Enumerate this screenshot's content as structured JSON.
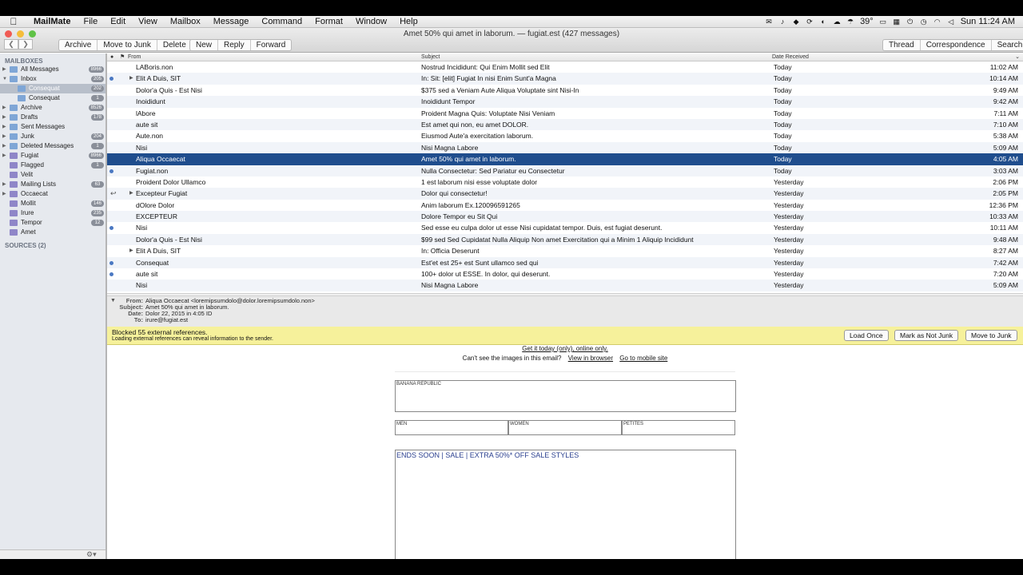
{
  "menubar": {
    "app_name": "MailMate",
    "items": [
      "File",
      "Edit",
      "View",
      "Mailbox",
      "Message",
      "Command",
      "Format",
      "Window",
      "Help"
    ],
    "temperature": "39°",
    "clock": "Sun 11:24 AM"
  },
  "window": {
    "title": "Amet 50% qui amet in laborum. — fugiat.est (427 messages)"
  },
  "toolbar": {
    "group1": [
      "Archive",
      "Move to Junk",
      "Delete"
    ],
    "group2": [
      "New",
      "Reply",
      "Forward"
    ],
    "group3": [
      "Thread",
      "Correspondence",
      "Search"
    ]
  },
  "sidebar": {
    "heading": "MAILBOXES",
    "items": [
      {
        "label": "All Messages",
        "count": "8966",
        "tri": "▶",
        "folder": "b"
      },
      {
        "label": "Inbox",
        "count": "205",
        "tri": "▼",
        "folder": "b"
      },
      {
        "label": "Consequat",
        "count": "202",
        "tri": "",
        "folder": "b",
        "indent": true
      },
      {
        "label": "Consequat",
        "count": "1",
        "tri": "",
        "folder": "b",
        "indent": true
      },
      {
        "label": "Archive",
        "count": "8526",
        "tri": "▶",
        "folder": "b"
      },
      {
        "label": "Drafts",
        "count": "178",
        "tri": "▶",
        "folder": "b"
      },
      {
        "label": "Sent Messages",
        "count": "",
        "tri": "▶",
        "folder": "b"
      },
      {
        "label": "Junk",
        "count": "204",
        "tri": "▶",
        "folder": "b"
      },
      {
        "label": "Deleted Messages",
        "count": "1",
        "tri": "▶",
        "folder": "b"
      },
      {
        "label": "Fugiat",
        "count": "8966",
        "tri": "▶",
        "folder": "p"
      },
      {
        "label": "Flagged",
        "count": "1",
        "tri": "",
        "folder": "p"
      },
      {
        "label": "Velit",
        "count": "",
        "tri": "",
        "folder": "p"
      },
      {
        "label": "Mailing Lists",
        "count": "63",
        "tri": "▶",
        "folder": "p"
      },
      {
        "label": "Occaecat",
        "count": "",
        "tri": "▶",
        "folder": "p"
      },
      {
        "label": "Mollit",
        "count": "146",
        "tri": "",
        "folder": "p"
      },
      {
        "label": "Irure",
        "count": "235",
        "tri": "",
        "folder": "p"
      },
      {
        "label": "Tempor",
        "count": "12",
        "tri": "",
        "folder": "p"
      },
      {
        "label": "Amet",
        "count": "",
        "tri": "",
        "folder": "p"
      }
    ],
    "sources": "SOURCES (2)"
  },
  "list": {
    "columns": {
      "from": "From",
      "subject": "Subject",
      "date": "Date Received"
    },
    "rows": [
      {
        "from": "LABoris.non",
        "subject": "Nostrud Incididunt: Qui Enim Mollit sed Elit",
        "date": "Today",
        "time": "11:02 AM",
        "dot": false,
        "thread": false,
        "arrow": false
      },
      {
        "from": "Elit A Duis, SIT",
        "subject": "In: Sit: [elit] Fugiat In nisi Enim Sunt'a Magna",
        "date": "Today",
        "time": "10:14 AM",
        "dot": true,
        "thread": true,
        "arrow": false
      },
      {
        "from": "Dolor'a Quis - Est Nisi",
        "subject": "$375 sed a Veniam Aute Aliqua Voluptate sint Nisi-In",
        "date": "Today",
        "time": "9:49 AM",
        "dot": false,
        "thread": false,
        "arrow": false
      },
      {
        "from": "Inoididunt",
        "subject": "Inoididunt Tempor",
        "date": "Today",
        "time": "9:42 AM",
        "dot": false,
        "thread": false,
        "arrow": false
      },
      {
        "from": "lAbore",
        "subject": "Proident Magna Quis: Voluptate Nisi Veniam",
        "date": "Today",
        "time": "7:11 AM",
        "dot": false,
        "thread": false,
        "arrow": false
      },
      {
        "from": "aute sit",
        "subject": "Est amet qui non, eu amet DOLOR.",
        "date": "Today",
        "time": "7:10 AM",
        "dot": false,
        "thread": false,
        "arrow": false
      },
      {
        "from": "Aute.non",
        "subject": "Eiusmod Aute'a exercitation laborum.",
        "date": "Today",
        "time": "5:38 AM",
        "dot": false,
        "thread": false,
        "arrow": false
      },
      {
        "from": "Nisi",
        "subject": "Nisi Magna Labore",
        "date": "Today",
        "time": "5:09 AM",
        "dot": false,
        "thread": false,
        "arrow": false
      },
      {
        "from": "Aliqua Occaecat",
        "subject": "Amet 50% qui amet in laborum.",
        "date": "Today",
        "time": "4:05 AM",
        "dot": false,
        "thread": false,
        "arrow": false,
        "selected": true
      },
      {
        "from": "Fugiat.non",
        "subject": "Nulla Consectetur: Sed Pariatur eu Consectetur",
        "date": "Today",
        "time": "3:03 AM",
        "dot": true,
        "thread": false,
        "arrow": false
      },
      {
        "from": "Proident Dolor Ullamco",
        "subject": "1 est laborum nisi esse voluptate dolor",
        "date": "Yesterday",
        "time": "2:06 PM",
        "dot": false,
        "thread": false,
        "arrow": false
      },
      {
        "from": "Excepteur Fugiat",
        "subject": "Dolor qui consectetur!",
        "date": "Yesterday",
        "time": "2:05 PM",
        "dot": false,
        "thread": true,
        "arrow": true
      },
      {
        "from": "dOlore Dolor",
        "subject": "Anim laborum Ex.120096591265",
        "date": "Yesterday",
        "time": "12:36 PM",
        "dot": false,
        "thread": false,
        "arrow": false
      },
      {
        "from": "EXCEPTEUR",
        "subject": "Dolore Tempor eu Sit Qui",
        "date": "Yesterday",
        "time": "10:33 AM",
        "dot": false,
        "thread": false,
        "arrow": false
      },
      {
        "from": "Nisi",
        "subject": "Sed esse eu culpa dolor ut esse Nisi cupidatat tempor. Duis, est fugiat deserunt.",
        "date": "Yesterday",
        "time": "10:11 AM",
        "dot": true,
        "thread": false,
        "arrow": false
      },
      {
        "from": "Dolor'a Quis - Est Nisi",
        "subject": "$99 sed Sed Cupidatat Nulla Aliquip Non amet Exercitation qui a Minim 1 Aliquip Incididunt",
        "date": "Yesterday",
        "time": "9:48 AM",
        "dot": false,
        "thread": false,
        "arrow": false
      },
      {
        "from": "Elit A Duis, SIT",
        "subject": "In: Officia Deserunt",
        "date": "Yesterday",
        "time": "8:27 AM",
        "dot": false,
        "thread": true,
        "arrow": false
      },
      {
        "from": "Consequat",
        "subject": "Est'et est 25+ est Sunt ullamco sed qui",
        "date": "Yesterday",
        "time": "7:42 AM",
        "dot": true,
        "thread": false,
        "arrow": false
      },
      {
        "from": "aute sit",
        "subject": "100+ dolor ut ESSE. In dolor, qui deserunt.",
        "date": "Yesterday",
        "time": "7:20 AM",
        "dot": true,
        "thread": false,
        "arrow": false
      },
      {
        "from": "Nisi",
        "subject": "Nisi Magna Labore",
        "date": "Yesterday",
        "time": "5:09 AM",
        "dot": false,
        "thread": false,
        "arrow": false
      }
    ]
  },
  "headers": {
    "from_label": "From:",
    "from": "Aliqua Occaecat <loremipsumdolo@dolor.loremipsumdolo.non>",
    "subject_label": "Subject:",
    "subject": "Amet 50% qui amet in laborum.",
    "date_label": "Date:",
    "date": "Dolor 22, 2015 in 4:05 ID",
    "to_label": "To:",
    "to": "irure@fugiat.est"
  },
  "junkbar": {
    "title": "Blocked 55 external references.",
    "subtitle": "Loading external references can reveal information to the sender.",
    "buttons": [
      "Load Once",
      "Mark as Not Junk",
      "Move to Junk"
    ]
  },
  "message": {
    "line1": "Get it today (only), online only.",
    "line2_text": "Can't see the images in this email?",
    "view_browser": "View in browser",
    "mobile": "Go to mobile site",
    "banner": "BANANA REPUBLIC",
    "nav": [
      "MEN",
      "WOMEN",
      "PETITES"
    ],
    "sale": "ENDS SOON | SALE | EXTRA 50%* OFF SALE STYLES"
  }
}
